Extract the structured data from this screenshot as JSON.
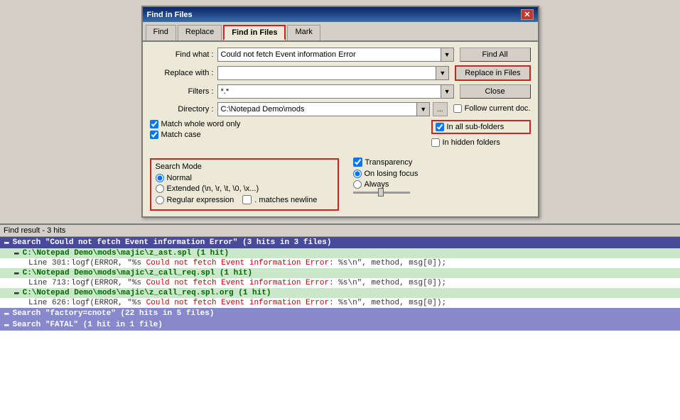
{
  "dialog": {
    "title": "Find in Files",
    "close_btn": "✕",
    "tabs": [
      "Find",
      "Replace",
      "Find in Files",
      "Mark"
    ],
    "active_tab": "Find in Files",
    "find_label": "Find what :",
    "find_value": "Could not fetch Event information Error",
    "replace_label": "Replace with :",
    "replace_value": "",
    "filters_label": "Filters :",
    "filters_value": "*.*",
    "directory_label": "Directory :",
    "directory_value": "C:\\Notepad Demo\\mods",
    "browse_label": "...",
    "btn_find_all": "Find All",
    "btn_replace_in_files": "Replace in Files",
    "btn_close": "Close",
    "follow_current": "Follow current doc.",
    "in_all_subfolders": "In all sub-folders",
    "in_hidden_folders": "In hidden folders",
    "match_whole_word": "Match whole word only",
    "match_case": "Match case",
    "search_mode_label": "Search Mode",
    "radio_normal": "Normal",
    "radio_extended": "Extended (\\n, \\r, \\t, \\0, \\x...)",
    "radio_regex": "Regular expression",
    "matches_newline": ". matches newline",
    "transparency_label": "Transparency",
    "on_losing_focus": "On losing focus",
    "always": "Always"
  },
  "results": {
    "header": "Find result - 3 hits",
    "lines": [
      {
        "type": "search-summary",
        "text": "Search \"Could not fetch Event information Error\" (3 hits in 3 files)"
      },
      {
        "type": "file-header",
        "text": "C:\\Notepad Demo\\mods\\majic\\z_ast.spl (1 hit)"
      },
      {
        "type": "code-line",
        "prefix": "Line 301:",
        "before": "        logf(ERROR, \"%s ",
        "highlight": "Could not fetch Event information Error",
        "after": ": %s\\n\", method, msg[0]);"
      },
      {
        "type": "file-header",
        "text": "C:\\Notepad Demo\\mods\\majic\\z_call_req.spl (1 hit)"
      },
      {
        "type": "code-line",
        "prefix": "Line 713:",
        "before": "        logf(ERROR, \"%s ",
        "highlight": "Could not fetch Event information Error",
        "after": ": %s\\n\", method, msg[0]);"
      },
      {
        "type": "file-header",
        "text": "C:\\Notepad Demo\\mods\\majic\\z_call_req.spl.org (1 hit)"
      },
      {
        "type": "code-line",
        "prefix": "Line 626:",
        "before": "        logf(ERROR, \"%s ",
        "highlight": "Could not fetch Event information Error",
        "after": ": %s\\n\", method, msg[0]);"
      },
      {
        "type": "search-summary2",
        "text": "Search \"factory=cnote\" (22 hits in 5 files)"
      },
      {
        "type": "search-summary3",
        "text": "Search \"FATAL\" (1 hit in 1 file)"
      }
    ]
  }
}
